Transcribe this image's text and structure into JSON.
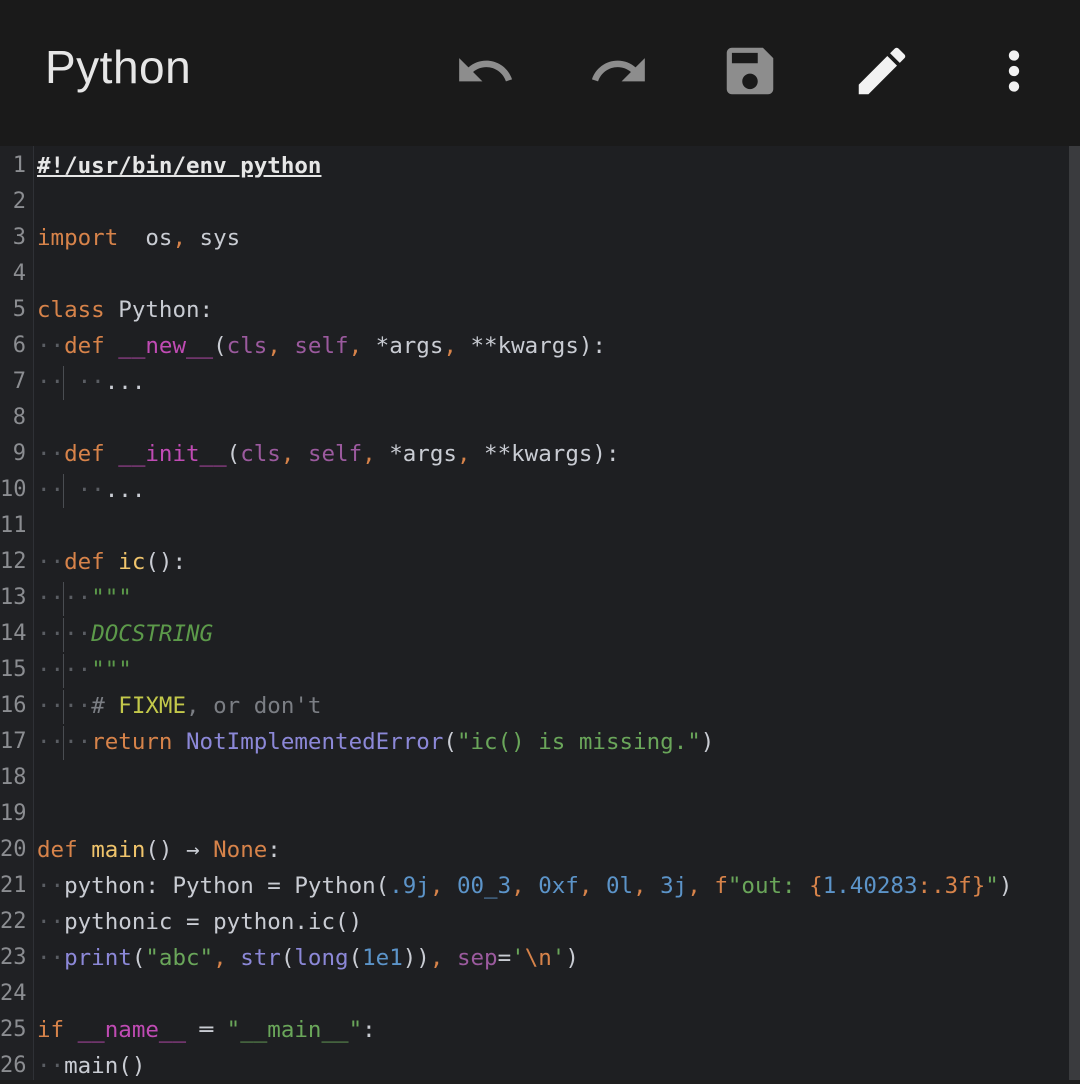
{
  "toolbar": {
    "title": "Python",
    "icons": [
      "undo-icon",
      "redo-icon",
      "save-icon",
      "edit-icon",
      "more-vert-icon"
    ]
  },
  "editor": {
    "lines": [
      {
        "n": "1",
        "tokens": [
          [
            "t-shebang",
            "#!/usr/bin/env python"
          ]
        ]
      },
      {
        "n": "2",
        "tokens": []
      },
      {
        "n": "3",
        "tokens": [
          [
            "t-kw",
            "import"
          ],
          [
            "",
            "  os"
          ],
          [
            "t-pun",
            ","
          ],
          [
            "",
            " sys"
          ]
        ]
      },
      {
        "n": "4",
        "tokens": []
      },
      {
        "n": "5",
        "tokens": [
          [
            "t-kw",
            "class"
          ],
          [
            "",
            " Python:"
          ]
        ]
      },
      {
        "n": "6",
        "tokens": [
          [
            "ws",
            "··"
          ],
          [
            "t-kw",
            "def"
          ],
          [
            "",
            " "
          ],
          [
            "t-dunder",
            "__new__"
          ],
          [
            "",
            "("
          ],
          [
            "t-self",
            "cls"
          ],
          [
            "t-pun",
            ","
          ],
          [
            "",
            " "
          ],
          [
            "t-self",
            "self"
          ],
          [
            "t-pun",
            ","
          ],
          [
            "",
            " *args"
          ],
          [
            "t-pun",
            ","
          ],
          [
            "",
            " **kwargs):"
          ]
        ]
      },
      {
        "n": "7",
        "tokens": [
          [
            "ws",
            "··"
          ],
          [
            "ws",
            " ··"
          ],
          [
            "",
            "..."
          ]
        ],
        "guide": 1
      },
      {
        "n": "8",
        "tokens": []
      },
      {
        "n": "9",
        "tokens": [
          [
            "ws",
            "··"
          ],
          [
            "t-kw",
            "def"
          ],
          [
            "",
            " "
          ],
          [
            "t-dunder",
            "__init__"
          ],
          [
            "",
            "("
          ],
          [
            "t-self",
            "cls"
          ],
          [
            "t-pun",
            ","
          ],
          [
            "",
            " "
          ],
          [
            "t-self",
            "self"
          ],
          [
            "t-pun",
            ","
          ],
          [
            "",
            " *args"
          ],
          [
            "t-pun",
            ","
          ],
          [
            "",
            " **kwargs):"
          ]
        ]
      },
      {
        "n": "10",
        "tokens": [
          [
            "ws",
            "··"
          ],
          [
            "ws",
            " ··"
          ],
          [
            "",
            "..."
          ]
        ],
        "guide": 1
      },
      {
        "n": "11",
        "tokens": []
      },
      {
        "n": "12",
        "tokens": [
          [
            "ws",
            "··"
          ],
          [
            "t-kw",
            "def"
          ],
          [
            "",
            " "
          ],
          [
            "t-def",
            "ic"
          ],
          [
            "",
            "():"
          ]
        ]
      },
      {
        "n": "13",
        "tokens": [
          [
            "ws",
            "····"
          ],
          [
            "t-doc",
            "\"\"\""
          ]
        ],
        "guide": 1
      },
      {
        "n": "14",
        "tokens": [
          [
            "ws",
            "····"
          ],
          [
            "t-doc",
            "DOCSTRING"
          ]
        ],
        "guide": 1
      },
      {
        "n": "15",
        "tokens": [
          [
            "ws",
            "····"
          ],
          [
            "t-doc",
            "\"\"\""
          ]
        ],
        "guide": 1
      },
      {
        "n": "16",
        "tokens": [
          [
            "ws",
            "····"
          ],
          [
            "t-com",
            "# "
          ],
          [
            "t-todo",
            "FIXME"
          ],
          [
            "t-com",
            ", or don't"
          ]
        ],
        "guide": 1
      },
      {
        "n": "17",
        "tokens": [
          [
            "ws",
            "····"
          ],
          [
            "t-kw",
            "return"
          ],
          [
            "",
            " "
          ],
          [
            "t-builtin",
            "NotImplementedError"
          ],
          [
            "",
            "("
          ],
          [
            "t-str",
            "\"ic() is missing.\""
          ],
          [
            "",
            ")"
          ]
        ],
        "guide": 1
      },
      {
        "n": "18",
        "tokens": []
      },
      {
        "n": "19",
        "tokens": []
      },
      {
        "n": "20",
        "tokens": [
          [
            "t-kw",
            "def"
          ],
          [
            "",
            " "
          ],
          [
            "t-def",
            "main"
          ],
          [
            "",
            "() → "
          ],
          [
            "t-kw",
            "None"
          ],
          [
            "",
            ":"
          ]
        ]
      },
      {
        "n": "21",
        "tokens": [
          [
            "ws",
            "··"
          ],
          [
            "",
            "python: Python = Python("
          ],
          [
            "t-num",
            ".9j"
          ],
          [
            "t-pun",
            ","
          ],
          [
            "",
            " "
          ],
          [
            "t-num",
            "00_3"
          ],
          [
            "t-pun",
            ","
          ],
          [
            "",
            " "
          ],
          [
            "t-num",
            "0xf"
          ],
          [
            "t-pun",
            ","
          ],
          [
            "",
            " "
          ],
          [
            "t-num",
            "0l"
          ],
          [
            "t-pun",
            ","
          ],
          [
            "",
            " "
          ],
          [
            "t-num",
            "3j"
          ],
          [
            "t-pun",
            ","
          ],
          [
            "",
            " "
          ],
          [
            "t-kw",
            "f"
          ],
          [
            "t-str",
            "\"out: "
          ],
          [
            "t-kw",
            "{"
          ],
          [
            "t-num",
            "1.40283"
          ],
          [
            "t-kw",
            ":.3f}"
          ],
          [
            "t-str",
            "\""
          ],
          [
            "",
            ")"
          ]
        ]
      },
      {
        "n": "22",
        "tokens": [
          [
            "ws",
            "··"
          ],
          [
            "",
            "pythonic = python.ic()"
          ]
        ]
      },
      {
        "n": "23",
        "tokens": [
          [
            "ws",
            "··"
          ],
          [
            "t-builtin",
            "print"
          ],
          [
            "",
            "("
          ],
          [
            "t-str",
            "\"abc\""
          ],
          [
            "t-pun",
            ","
          ],
          [
            "",
            " "
          ],
          [
            "t-builtin",
            "str"
          ],
          [
            "",
            "("
          ],
          [
            "t-builtin",
            "long"
          ],
          [
            "",
            "("
          ],
          [
            "t-num",
            "1e1"
          ],
          [
            "",
            "))"
          ],
          [
            "t-pun",
            ","
          ],
          [
            "",
            " "
          ],
          [
            "t-self",
            "sep"
          ],
          [
            "",
            "="
          ],
          [
            "t-str",
            "'"
          ],
          [
            "t-esc",
            "\\n"
          ],
          [
            "t-str",
            "'"
          ],
          [
            "",
            ")"
          ]
        ]
      },
      {
        "n": "24",
        "tokens": []
      },
      {
        "n": "25",
        "tokens": [
          [
            "t-kw",
            "if"
          ],
          [
            "",
            " "
          ],
          [
            "t-dunder",
            "__name__"
          ],
          [
            "",
            " ═ "
          ],
          [
            "t-str",
            "\"__main__\""
          ],
          [
            "",
            ":"
          ]
        ]
      },
      {
        "n": "26",
        "tokens": [
          [
            "ws",
            "··"
          ],
          [
            "",
            "main()"
          ]
        ]
      }
    ]
  }
}
